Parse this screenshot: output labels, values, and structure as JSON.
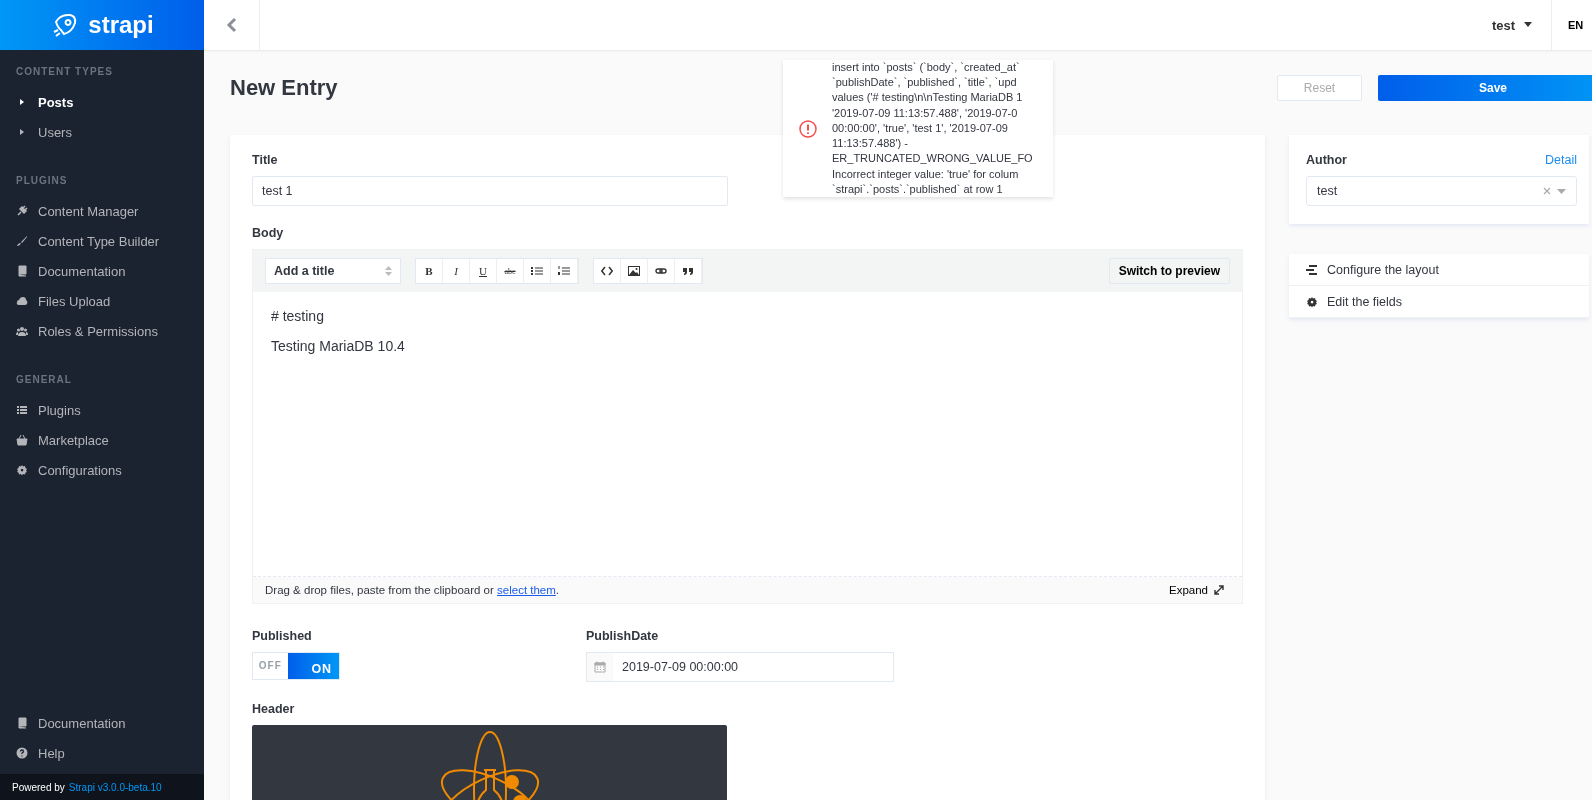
{
  "brand": {
    "name": "strapi"
  },
  "sidebar": {
    "sections": [
      {
        "heading": "CONTENT TYPES",
        "items": [
          {
            "label": "Posts",
            "selected": true
          },
          {
            "label": "Users",
            "selected": false
          }
        ]
      },
      {
        "heading": "PLUGINS",
        "items": [
          {
            "label": "Content Manager",
            "selected": false
          },
          {
            "label": "Content Type Builder",
            "selected": false
          },
          {
            "label": "Documentation",
            "selected": false
          },
          {
            "label": "Files Upload",
            "selected": false
          },
          {
            "label": "Roles & Permissions",
            "selected": false
          }
        ]
      },
      {
        "heading": "GENERAL",
        "items": [
          {
            "label": "Plugins",
            "selected": false
          },
          {
            "label": "Marketplace",
            "selected": false
          },
          {
            "label": "Configurations",
            "selected": false
          }
        ]
      }
    ],
    "footer_items": [
      "Documentation",
      "Help"
    ],
    "powered_by": "Powered by",
    "version_link": "Strapi v3.0.0-beta.10"
  },
  "topbar": {
    "user": "test",
    "language": "EN"
  },
  "page": {
    "title": "New Entry",
    "reset": "Reset",
    "save": "Save"
  },
  "toast": {
    "lines": [
      "insert into `posts` (`body`, `created_at`",
      "`publishDate`, `published`, `title`, `upd",
      "values ('# testing\\n\\nTesting MariaDB 1",
      "'2019-07-09 11:13:57.488', '2019-07-0",
      "00:00:00', 'true', 'test 1', '2019-07-09",
      "11:13:57.488') -",
      "ER_TRUNCATED_WRONG_VALUE_FO",
      "Incorrect integer value: 'true' for colum",
      "`strapi`.`posts`.`published` at row 1"
    ]
  },
  "form": {
    "title_label": "Title",
    "title_value": "test 1",
    "body_label": "Body",
    "editor": {
      "heading_select": "Add a title",
      "format_buttons": [
        "B",
        "I",
        "U",
        "abc"
      ],
      "preview_button": "Switch to preview",
      "content_lines": [
        "# testing",
        "Testing MariaDB 10.4"
      ],
      "hint": "Drag & drop files, paste from the clipboard or ",
      "hint_link": "select them",
      "hint_end": ".",
      "expand": "Expand"
    },
    "published_label": "Published",
    "toggle": {
      "off": "OFF",
      "on_label": "ON",
      "on": true
    },
    "date_label": "PublishDate",
    "date_value": "2019-07-09 00:00:00",
    "header_label": "Header"
  },
  "aside": {
    "author_label": "Author",
    "details_link": "Detail",
    "author_value": "test",
    "actions": [
      "Configure the layout",
      "Edit the fields"
    ]
  }
}
